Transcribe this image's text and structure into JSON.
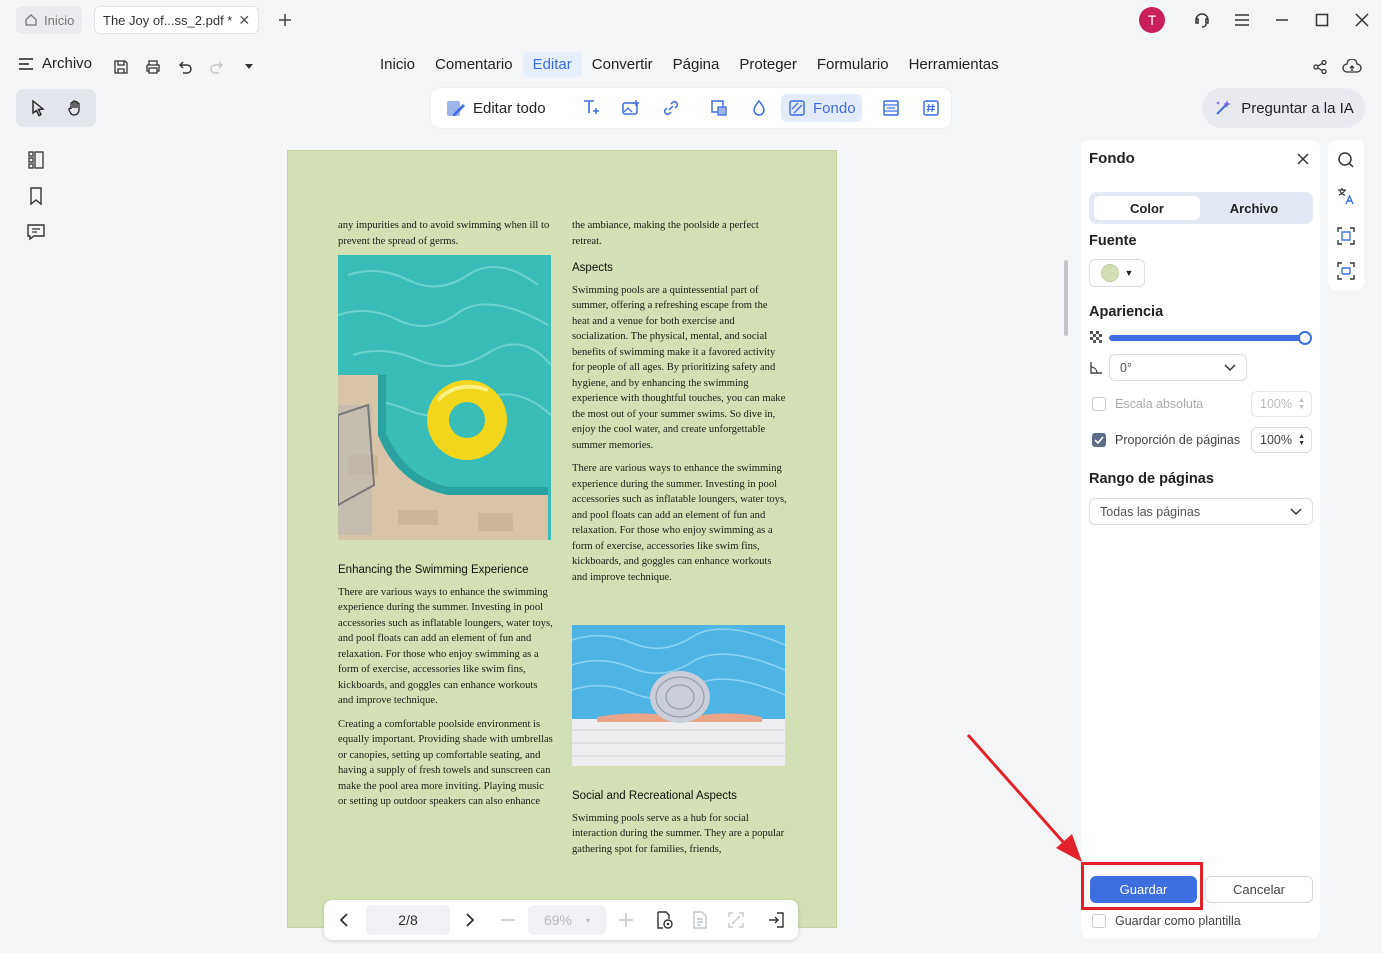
{
  "titlebar": {
    "home_tab": "Inicio",
    "doc_tab": "The Joy of...ss_2.pdf *",
    "avatar_letter": "T"
  },
  "menubar": {
    "archivo": "Archivo",
    "items": [
      "Inicio",
      "Comentario",
      "Editar",
      "Convertir",
      "Página",
      "Proteger",
      "Formulario",
      "Herramientas"
    ],
    "active": "Editar"
  },
  "edit_toolbar": {
    "edit_all": "Editar todo",
    "background": "Fondo"
  },
  "ask_ai": "Preguntar a la IA",
  "page": {
    "left_col_intro": "any impurities and to avoid swimming when ill to prevent the spread of germs.",
    "left_heading": "Enhancing the Swimming Experience",
    "left_p1": "There are various ways to enhance the swimming experience during the summer. Investing in pool accessories such as inflatable loungers, water toys, and pool floats can add an element of fun and relaxation. For those who enjoy swimming as a form of exercise, accessories like swim fins, kickboards, and goggles can enhance workouts and improve technique.",
    "left_p2": "Creating a comfortable poolside environment is equally important. Providing shade with umbrellas or canopies, setting up comfortable seating, and having a supply of fresh towels and sunscreen can make the pool area more inviting. Playing music or setting up outdoor speakers can also enhance",
    "right_col_intro": "the ambiance, making the poolside a perfect retreat.",
    "right_heading1": "Aspects",
    "right_p1": "Swimming pools are a quintessential part of summer, offering a refreshing escape from the heat and a venue for both exercise and socialization. The physical, mental, and social benefits of swimming make it a favored activity for people of all ages. By prioritizing safety and hygiene, and by enhancing the swimming experience with thoughtful touches, you can make the most out of your summer swims. So dive in, enjoy the cool water, and create unforgettable summer memories.",
    "right_p2": "There are various ways to enhance the swimming experience during the summer. Investing in pool accessories such as inflatable loungers, water toys, and pool floats can add an element of fun and relaxation. For those who enjoy swimming as a form of exercise, accessories like swim fins, kickboards, and goggles can enhance workouts and improve technique.",
    "right_heading2": "Social and Recreational Aspects",
    "right_p3": "Swimming pools serve as a hub for social interaction during the summer. They are a popular gathering spot for families, friends,"
  },
  "pagenav": {
    "page": "2/8",
    "zoom": "69%"
  },
  "panel": {
    "title": "Fondo",
    "tabs": [
      "Color",
      "Archivo"
    ],
    "active_tab": "Color",
    "source_label": "Fuente",
    "source_color": "#d3e0b5",
    "appearance_label": "Apariencia",
    "opacity_level": 1.0,
    "rotation": "0°",
    "absolute_scale_label": "Escala absoluta",
    "absolute_scale_value": "100%",
    "page_ratio_label": "Proporción de páginas",
    "page_ratio_value": "100%",
    "range_label": "Rango de páginas",
    "range_value": "Todas las páginas",
    "save": "Guardar",
    "cancel": "Cancelar",
    "save_template": "Guardar como plantilla"
  },
  "colors": {
    "accent": "#3d6fe0",
    "page_background": "#d3e0b5",
    "highlight": "#e2222a"
  }
}
